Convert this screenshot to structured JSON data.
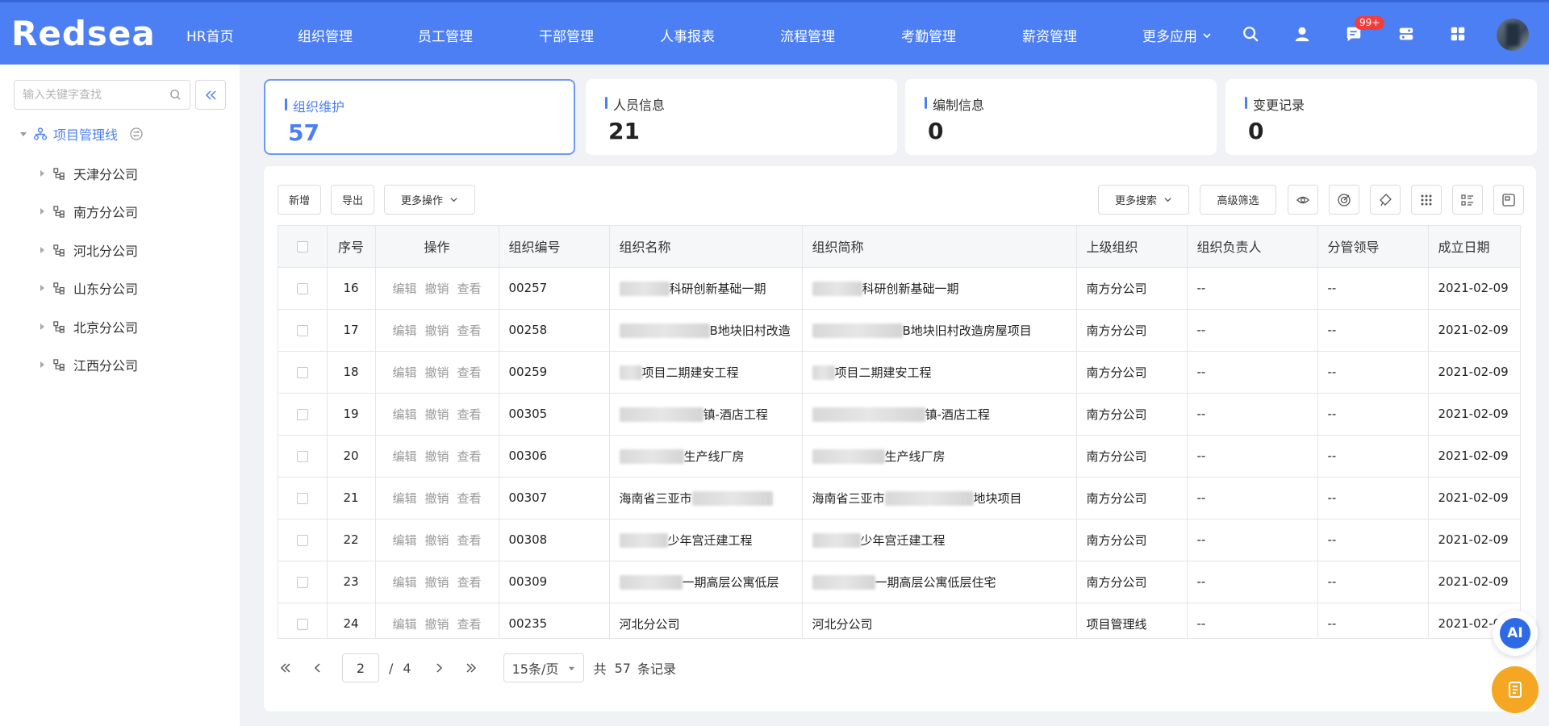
{
  "header": {
    "logo": "Redsea",
    "nav": [
      "HR首页",
      "组织管理",
      "员工管理",
      "干部管理",
      "人事报表",
      "流程管理",
      "考勤管理",
      "薪资管理"
    ],
    "more_apps": "更多应用",
    "notification_badge": "99+",
    "icons": [
      "search-icon",
      "user-icon",
      "message-icon",
      "switch-icon",
      "apps-grid-icon"
    ]
  },
  "sidebar": {
    "search_placeholder": "输入关键字查找",
    "root": "项目管理线",
    "items": [
      "天津分公司",
      "南方分公司",
      "河北分公司",
      "山东分公司",
      "北京分公司",
      "江西分公司"
    ]
  },
  "cards": [
    {
      "label": "组织维护",
      "value": "57"
    },
    {
      "label": "人员信息",
      "value": "21"
    },
    {
      "label": "编制信息",
      "value": "0"
    },
    {
      "label": "变更记录",
      "value": "0"
    }
  ],
  "toolbar": {
    "add": "新增",
    "export": "导出",
    "more_ops": "更多操作",
    "more_search": "更多搜索",
    "advanced_filter": "高级筛选"
  },
  "table": {
    "columns": [
      "序号",
      "操作",
      "组织编号",
      "组织名称",
      "组织简称",
      "上级组织",
      "组织负责人",
      "分管领导",
      "成立日期"
    ],
    "actions": [
      "编辑",
      "撤销",
      "查看"
    ],
    "rows": [
      {
        "no": "16",
        "code": "00257",
        "name": "科研创新基础一期",
        "short": "科研创新基础一期",
        "parent": "南方分公司",
        "head": "--",
        "leader": "--",
        "date": "2021-02-09"
      },
      {
        "no": "17",
        "code": "00258",
        "name": "B地块旧村改造",
        "short": "B地块旧村改造房屋项目",
        "parent": "南方分公司",
        "head": "--",
        "leader": "--",
        "date": "2021-02-09"
      },
      {
        "no": "18",
        "code": "00259",
        "name": "项目二期建安工程",
        "short": "项目二期建安工程",
        "parent": "南方分公司",
        "head": "--",
        "leader": "--",
        "date": "2021-02-09"
      },
      {
        "no": "19",
        "code": "00305",
        "name": "镇-酒店工程",
        "short": "镇-酒店工程",
        "parent": "南方分公司",
        "head": "--",
        "leader": "--",
        "date": "2021-02-09"
      },
      {
        "no": "20",
        "code": "00306",
        "name": "生产线厂房",
        "short": "生产线厂房",
        "parent": "南方分公司",
        "head": "--",
        "leader": "--",
        "date": "2021-02-09"
      },
      {
        "no": "21",
        "code": "00307",
        "name": "海南省三亚市",
        "short": "海南省三亚市",
        "short_tail": "地块项目",
        "parent": "南方分公司",
        "head": "--",
        "leader": "--",
        "date": "2021-02-09"
      },
      {
        "no": "22",
        "code": "00308",
        "name": "少年宫迁建工程",
        "short": "少年宫迁建工程",
        "parent": "南方分公司",
        "head": "--",
        "leader": "--",
        "date": "2021-02-09"
      },
      {
        "no": "23",
        "code": "00309",
        "name": "一期高层公寓低层",
        "short": "一期高层公寓低层住宅",
        "parent": "南方分公司",
        "head": "--",
        "leader": "--",
        "date": "2021-02-09"
      },
      {
        "no": "24",
        "code": "00235",
        "name": "河北分公司",
        "short": "河北分公司",
        "parent": "项目管理线",
        "head": "--",
        "leader": "--",
        "date": "2021-02-09"
      }
    ]
  },
  "pagination": {
    "current": "2",
    "separator": "/",
    "total_pages": "4",
    "page_size": "15条/页",
    "total_prefix": "共",
    "total": "57",
    "total_suffix": "条记录"
  },
  "floating": {
    "ai_label": "AI"
  }
}
